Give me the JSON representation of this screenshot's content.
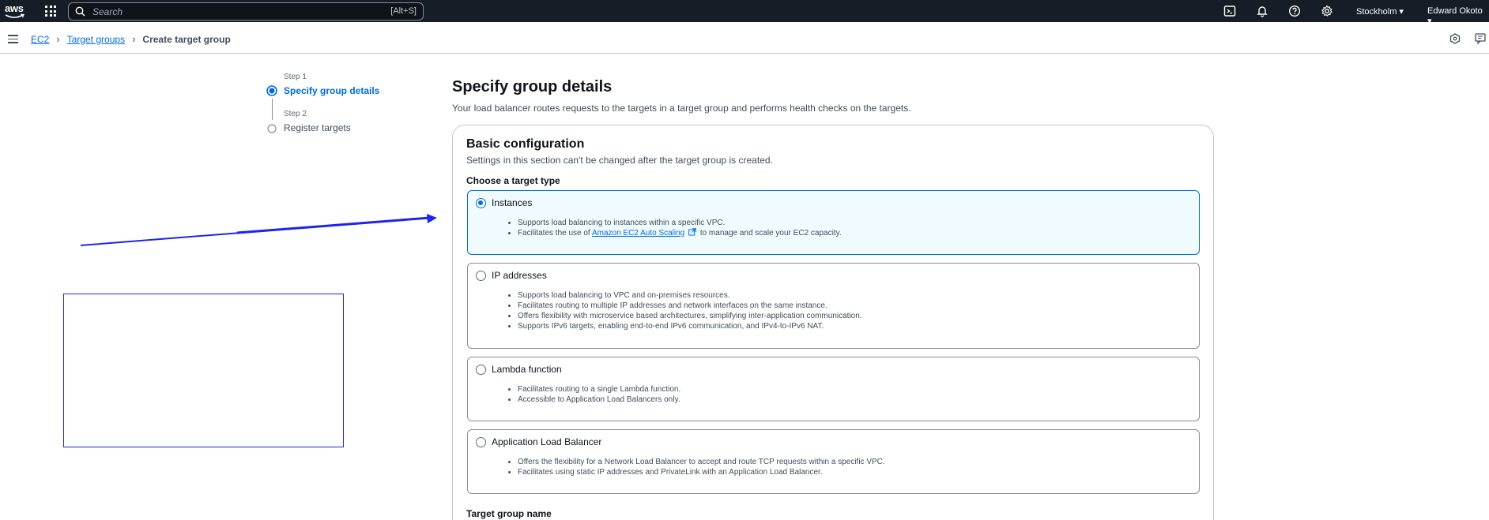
{
  "topnav": {
    "logo_text": "aws",
    "search_placeholder": "Search",
    "search_shortcut": "[Alt+S]",
    "region": "Stockholm ▾",
    "user": "Edward Okoto ▾"
  },
  "breadcrumb": {
    "items": [
      "EC2",
      "Target groups"
    ],
    "current": "Create target group"
  },
  "steps": [
    {
      "label": "Step 1",
      "title": "Specify group details"
    },
    {
      "label": "Step 2",
      "title": "Register targets"
    }
  ],
  "main": {
    "title": "Specify group details",
    "description": "Your load balancer routes requests to the targets in a target group and performs health checks on the targets."
  },
  "basic": {
    "title": "Basic configuration",
    "description": "Settings in this section can't be changed after the target group is created.",
    "choose_label": "Choose a target type",
    "tiles": [
      {
        "title": "Instances",
        "selected": true,
        "bullets": [
          "Supports load balancing to instances within a specific VPC.",
          "to manage and scale your EC2 capacity."
        ],
        "bullet2_prefix": "Facilitates the use of ",
        "bullet2_link": "Amazon EC2 Auto Scaling"
      },
      {
        "title": "IP addresses",
        "selected": false,
        "bullets": [
          "Supports load balancing to VPC and on-premises resources.",
          "Facilitates routing to multiple IP addresses and network interfaces on the same instance.",
          "Offers flexibility with microservice based architectures, simplifying inter-application communication.",
          "Supports IPv6 targets, enabling end-to-end IPv6 communication, and IPv4-to-IPv6 NAT."
        ]
      },
      {
        "title": "Lambda function",
        "selected": false,
        "bullets": [
          "Facilitates routing to a single Lambda function.",
          "Accessible to Application Load Balancers only."
        ]
      },
      {
        "title": "Application Load Balancer",
        "selected": false,
        "bullets": [
          "Offers the flexibility for a Network Load Balancer to accept and route TCP requests within a specific VPC.",
          "Facilitates using static IP addresses and PrivateLink with an Application Load Balancer."
        ]
      }
    ],
    "target_group_name_label": "Target group name"
  },
  "colors": {
    "nav_bg": "#161d26",
    "link": "#006ce0",
    "selected_tile_bg": "#f0fbff",
    "annotation": "#1f24e8"
  }
}
